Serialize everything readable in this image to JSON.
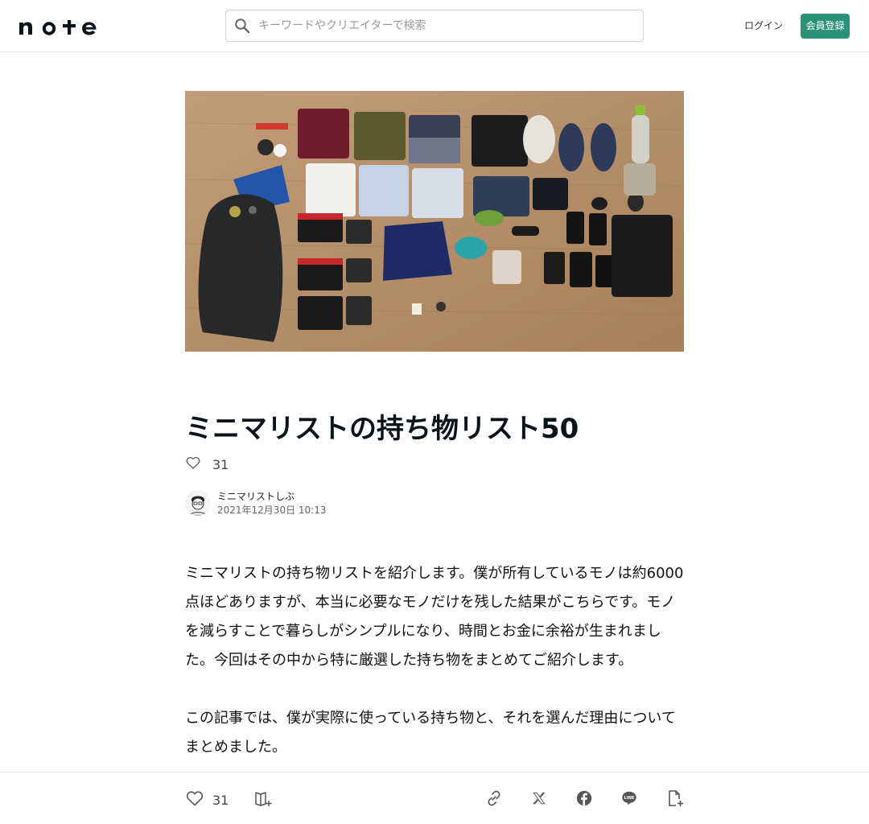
{
  "header": {
    "logo_text": "note",
    "search_placeholder": "キーワードやクリエイターで検索",
    "login_label": "ログイン",
    "signup_label": "会員登録"
  },
  "article": {
    "title": "ミニマリストの持ち物リスト50",
    "like_count": "31",
    "author_name": "ミニマリストしぶ",
    "date": "2021年12月30日 10:13",
    "paragraphs": [
      "ミニマリストの持ち物リストを紹介します。僕が所有しているモノは約6000点ほどありますが、本当に必要なモノだけを残した結果がこちらです。モノを減らすことで暮らしがシンプルになり、時間とお金に余裕が生まれました。今回はその中から特に厳選した持ち物をまとめてご紹介します。",
      "この記事では、僕が実際に使っている持ち物と、それを選んだ理由についてまとめました。"
    ]
  },
  "bottom_bar": {
    "like_count": "31"
  },
  "icons": {
    "search": "search-icon",
    "heart": "heart-icon",
    "magazine": "add-to-magazine-icon",
    "link": "link-icon",
    "x": "x-share-icon",
    "facebook": "facebook-icon",
    "line": "line-icon",
    "save": "add-note-icon"
  },
  "colors": {
    "accent": "#2b9277",
    "text": "#08131a"
  }
}
